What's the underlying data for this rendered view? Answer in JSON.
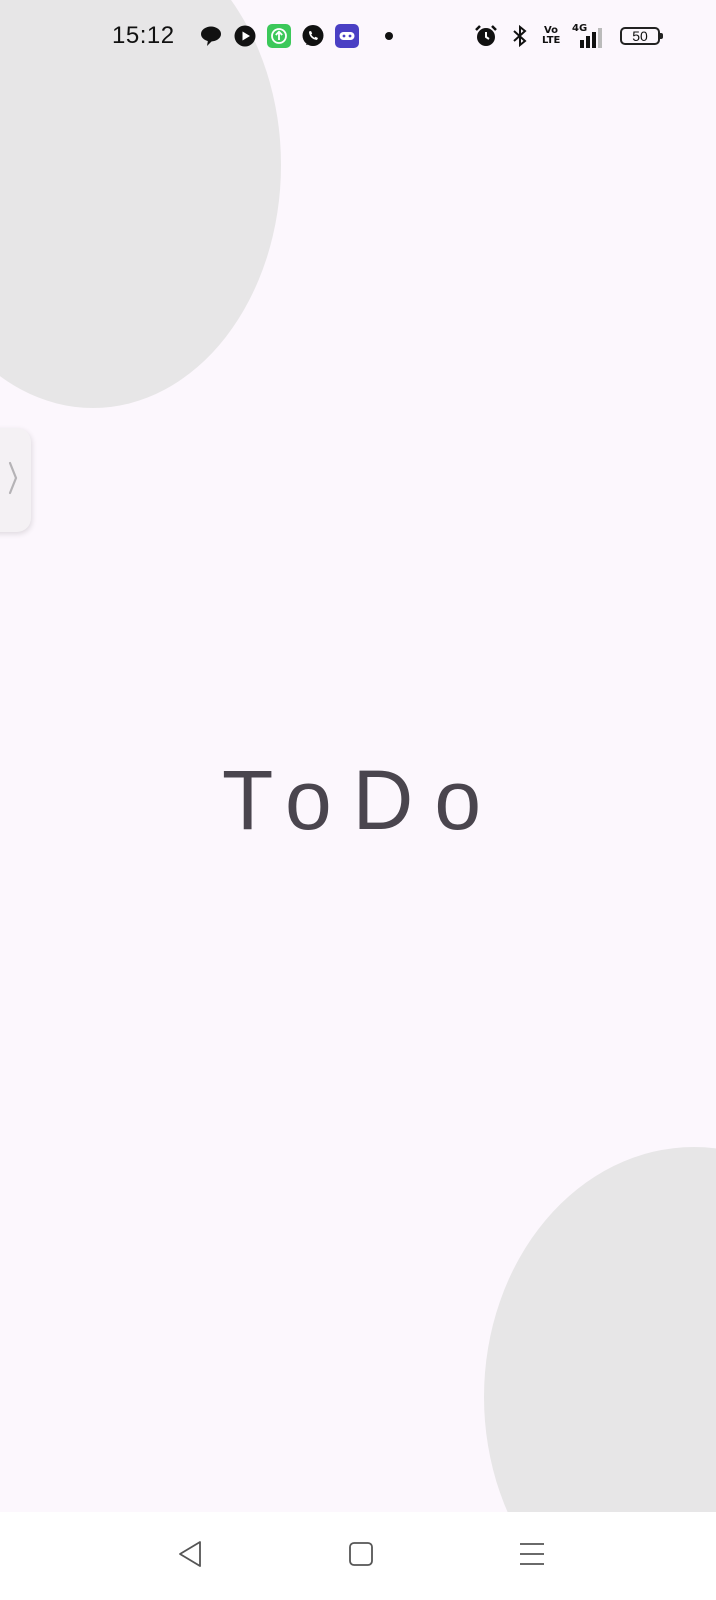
{
  "status_bar": {
    "time": "15:12",
    "notification_icons": [
      "chat-bubble-icon",
      "play-icon",
      "upload-icon",
      "viber-icon",
      "game-controller-icon",
      "dot-icon"
    ],
    "system_icons": [
      "alarm-icon",
      "bluetooth-icon",
      "volte-icon",
      "signal-4g-icon",
      "battery-icon"
    ],
    "volte_top": "Vo",
    "volte_bottom": "LTE",
    "network_type": "4G",
    "battery_level": "50"
  },
  "app": {
    "title": "ToDo"
  },
  "edge_handle": {
    "icon": "chevron-right-icon"
  },
  "nav_bar": {
    "buttons": [
      "back-triangle-icon",
      "home-square-icon",
      "menu-lines-icon"
    ]
  },
  "colors": {
    "background": "#fcf7fd",
    "circle": "#e7e6e7",
    "title": "#4a454e",
    "nav_background": "#ffffff",
    "upload_icon_bg": "#3cc85a",
    "game_icon_bg": "#4a3fc4"
  }
}
